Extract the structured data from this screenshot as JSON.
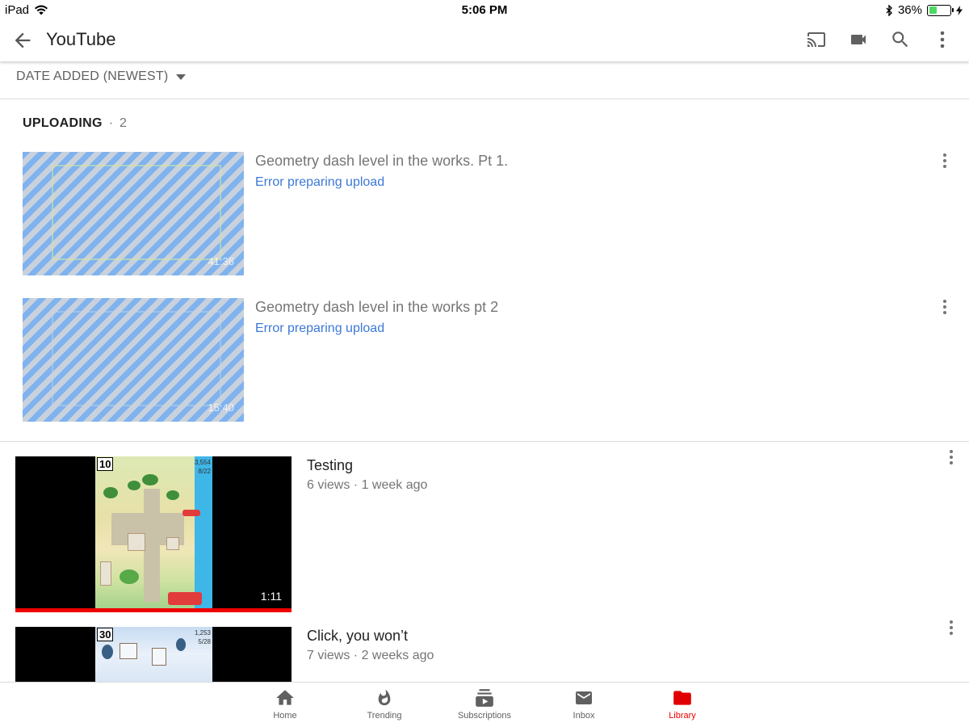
{
  "status_bar": {
    "device": "iPad",
    "time": "5:06 PM",
    "battery": "36%",
    "battery_level": 0.36
  },
  "app_bar": {
    "title": "YouTube",
    "actions": [
      "cast-icon",
      "video-camera-icon",
      "search-icon",
      "more-vert-icon"
    ]
  },
  "sort": {
    "label": "DATE ADDED (NEWEST)"
  },
  "uploading": {
    "label": "UPLOADING",
    "separator": "·",
    "count": "2",
    "items": [
      {
        "title": "Geometry dash level in the works. Pt 1.",
        "status": "Error preparing upload",
        "duration": "41:36"
      },
      {
        "title": "Geometry dash level in the works pt 2",
        "status": "Error preparing upload",
        "duration": "15:40"
      }
    ]
  },
  "videos": [
    {
      "title": "Testing",
      "meta": "6 views · 1 week ago",
      "duration": "1:11",
      "hud_level": "10",
      "hud_score": "3,554",
      "hud_sub": "8/22",
      "watched": 1.0
    },
    {
      "title": "Click, you won’t",
      "meta": "7 views · 2 weeks ago",
      "hud_level": "30",
      "hud_score": "1,253",
      "hud_sub": "5/28"
    }
  ],
  "bottom_nav": [
    {
      "label": "Home",
      "icon": "home-icon",
      "active": false
    },
    {
      "label": "Trending",
      "icon": "flame-icon",
      "active": false
    },
    {
      "label": "Subscriptions",
      "icon": "subscriptions-icon",
      "active": false
    },
    {
      "label": "Inbox",
      "icon": "mail-icon",
      "active": false
    },
    {
      "label": "Library",
      "icon": "folder-icon",
      "active": true
    }
  ],
  "colors": {
    "accent": "#e00000",
    "link": "#3c78d8",
    "secondary_text": "#757575"
  }
}
